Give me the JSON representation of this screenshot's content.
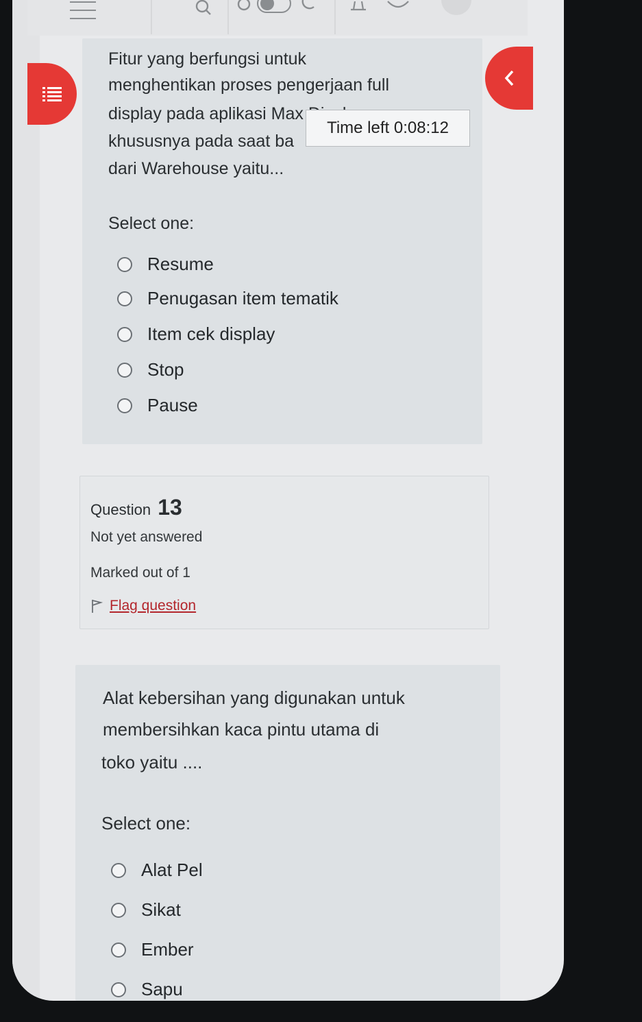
{
  "timer": {
    "label": "Time left",
    "value": "0:08:12"
  },
  "question12": {
    "text_lines": [
      "Fitur yang berfungsi untuk",
      "menghentikan proses pengerjaan full",
      "display pada aplikasi Max Display",
      "khususnya pada saat ba",
      "dari Warehouse yaitu..."
    ],
    "select_label": "Select one:",
    "options": [
      "Resume",
      "Penugasan item tematik",
      "Item cek display",
      "Stop",
      "Pause"
    ]
  },
  "question13": {
    "label": "Question",
    "number": "13",
    "status": "Not yet answered",
    "marks": "Marked out of 1",
    "flag_label": "Flag question",
    "text_lines": [
      "Alat kebersihan yang digunakan untuk",
      "membersihkan kaca pintu utama di",
      "toko yaitu ...."
    ],
    "select_label": "Select one:",
    "options": [
      "Alat Pel",
      "Sikat",
      "Ember",
      "Sapu"
    ]
  },
  "colors": {
    "accent": "#e53935",
    "link": "#b3262c",
    "card": "#dde1e4"
  },
  "icons": [
    "menu-icon",
    "search-icon",
    "brightness-icon",
    "toggle-icon",
    "moon-icon",
    "bell-icon",
    "chat-icon",
    "list-icon",
    "chevron-left-icon",
    "flag-icon"
  ]
}
